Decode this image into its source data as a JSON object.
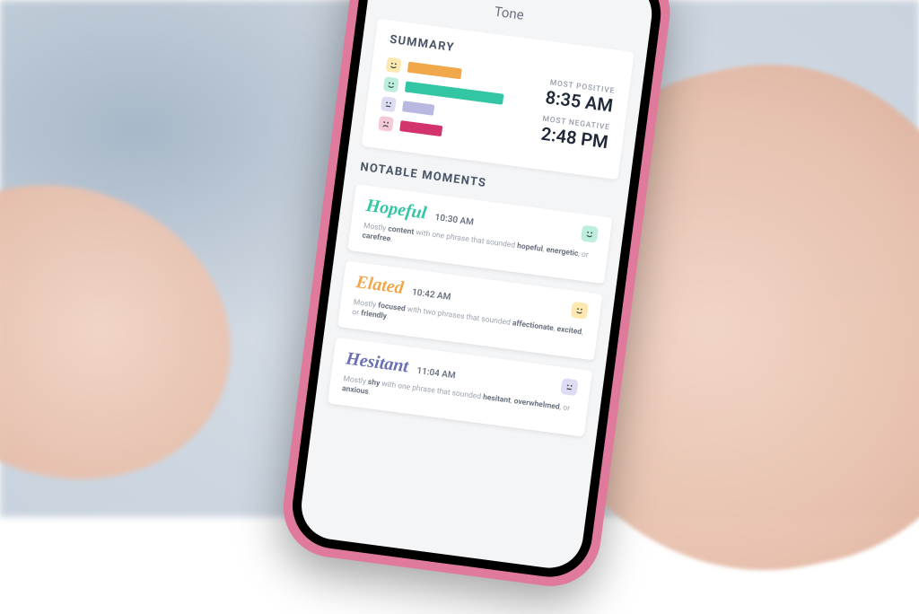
{
  "page_title": "Tone",
  "summary": {
    "header": "SUMMARY",
    "most_positive_label": "MOST POSITIVE",
    "most_positive_time": "8:35 AM",
    "most_negative_label": "MOST NEGATIVE",
    "most_negative_time": "2:48 PM"
  },
  "chart_data": {
    "type": "bar",
    "orientation": "horizontal",
    "categories": [
      "elated",
      "hopeful",
      "hesitant",
      "negative"
    ],
    "values": [
      48,
      88,
      28,
      38
    ],
    "colors": [
      "#f0a84b",
      "#33c6a4",
      "#b9b8e0",
      "#d3336c"
    ],
    "face_classes": [
      "face-amber",
      "face-teal",
      "face-lav",
      "face-mag"
    ],
    "face_moods": [
      "happy",
      "happy",
      "neutral",
      "sad"
    ],
    "xlim": [
      0,
      100
    ],
    "title": "",
    "xlabel": "",
    "ylabel": ""
  },
  "notable": {
    "header": "NOTABLE MOMENTS",
    "moments": [
      {
        "name": "Hopeful",
        "color": "#33c6a4",
        "time": "10:30 AM",
        "face_class": "face-teal",
        "face_mood": "happy",
        "desc_lead": "Mostly ",
        "desc_em": "content",
        "desc_mid": " with one phrase that sounded ",
        "kw1": "hopeful",
        "kw2": "energetic",
        "kw3": "carefree",
        "desc_tail": "."
      },
      {
        "name": "Elated",
        "color": "#f0a84b",
        "time": "10:42 AM",
        "face_class": "face-amber",
        "face_mood": "happy",
        "desc_lead": "Mostly ",
        "desc_em": "focused",
        "desc_mid": " with two phrases that sounded ",
        "kw1": "affectionate",
        "kw2": "excited",
        "kw3": "friendly",
        "desc_tail": "."
      },
      {
        "name": "Hesitant",
        "color": "#6b6fb5",
        "time": "11:04 AM",
        "face_class": "face-lav",
        "face_mood": "neutral",
        "desc_lead": "Mostly ",
        "desc_em": "shy",
        "desc_mid": " with one phrase that sounded ",
        "kw1": "hesitant",
        "kw2": "overwhelmed",
        "kw3": "anxious",
        "desc_tail": "."
      }
    ]
  }
}
